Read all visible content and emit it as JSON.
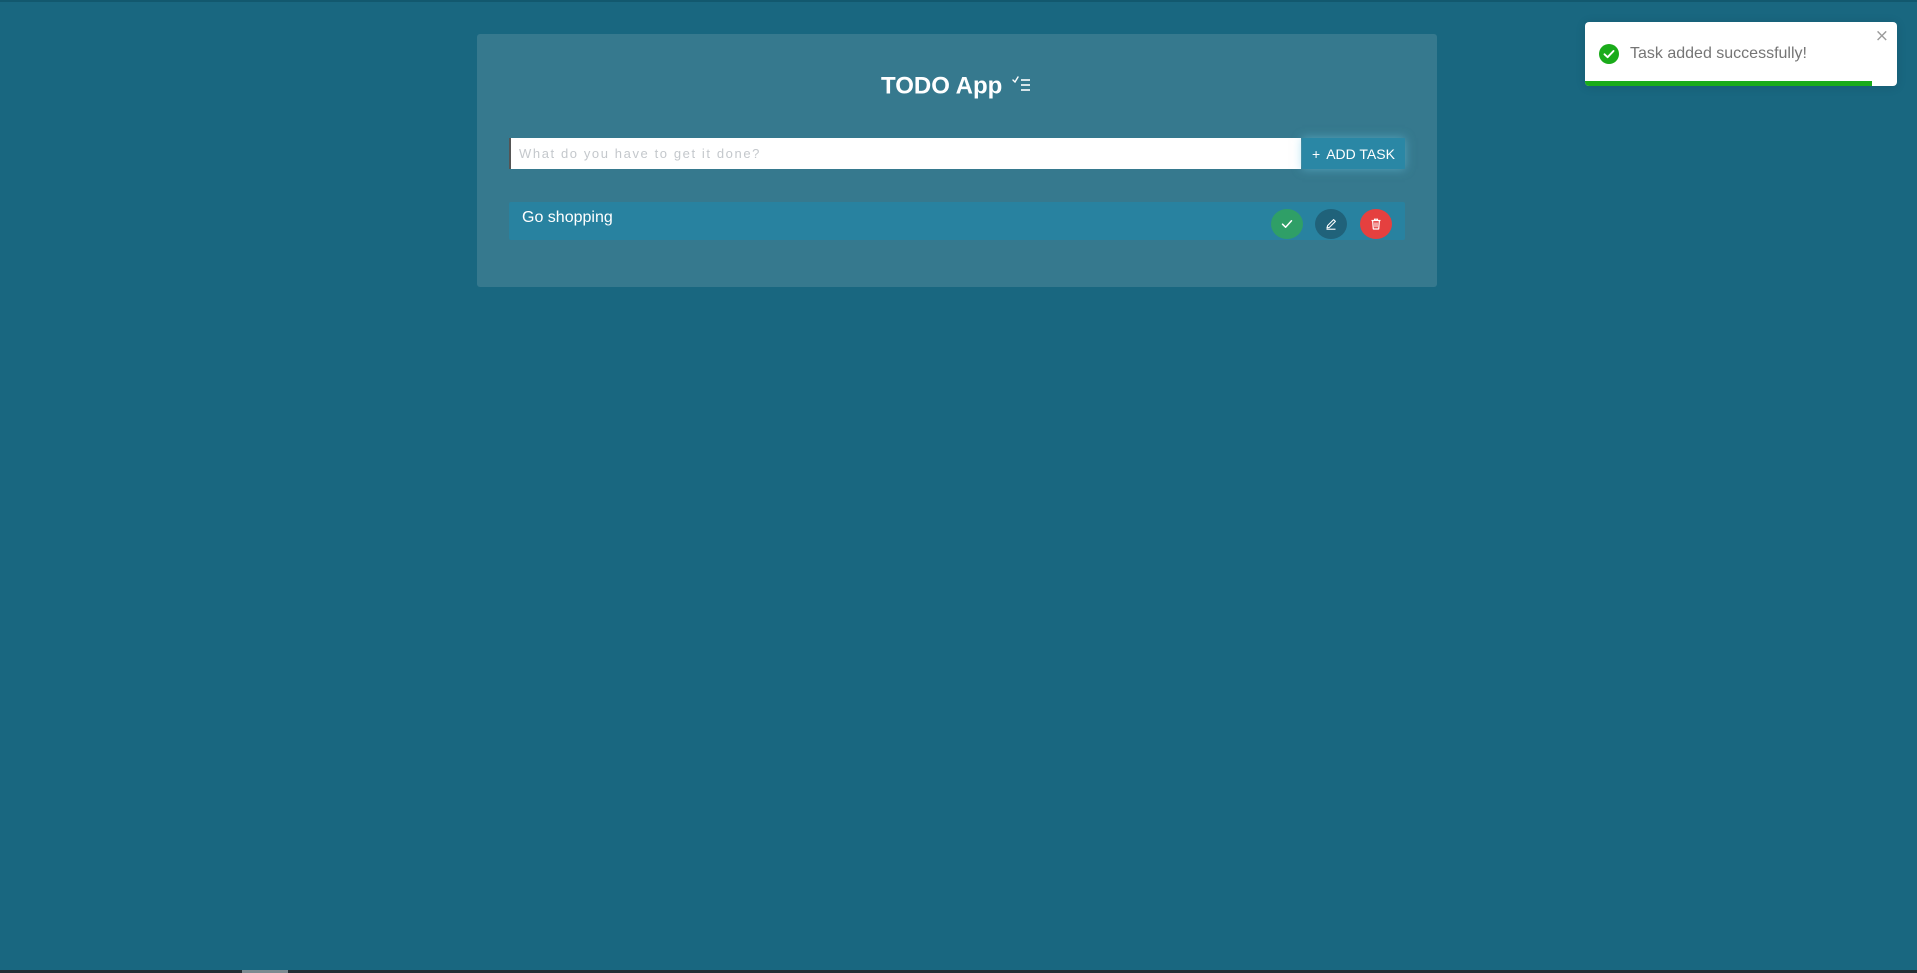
{
  "app": {
    "title": "TODO App",
    "title_icon": "checklist-icon"
  },
  "form": {
    "input_value": "",
    "input_placeholder": "What do you have to get it done?",
    "add_button_icon": "+",
    "add_button_label": "ADD TASK"
  },
  "tasks": [
    {
      "label": "Go shopping",
      "actions": [
        {
          "name": "complete-button",
          "icon": "check-icon",
          "color": "#2f9f67"
        },
        {
          "name": "edit-button",
          "icon": "pencil-icon",
          "color": "#20627a"
        },
        {
          "name": "delete-button",
          "icon": "trash-icon",
          "color": "#e5403f"
        }
      ]
    }
  ],
  "toast": {
    "message": "Task added successfully!",
    "status_icon": "success-check-icon",
    "close_icon": "close-icon",
    "close_glyph": "×",
    "progress": 0.92,
    "accent_color": "#1aab1a"
  },
  "colors": {
    "background": "#196780",
    "card": "#36798e",
    "task_row": "#2882a0",
    "add_button": "#2a87a5"
  }
}
